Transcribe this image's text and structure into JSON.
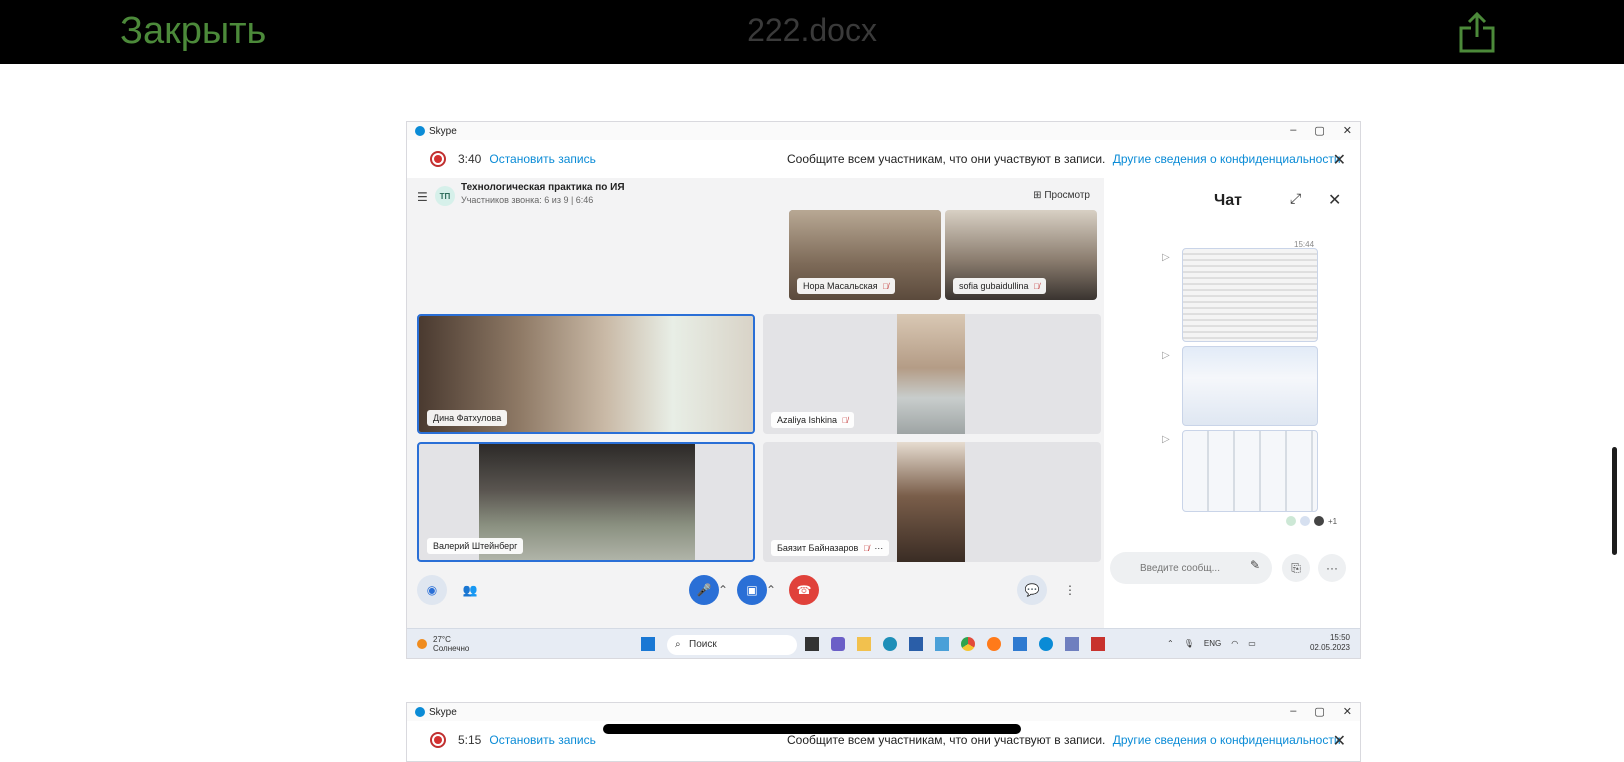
{
  "viewer": {
    "close_label": "Закрыть",
    "doc_title": "222.docx",
    "share_icon": "share-icon",
    "accent_color": "#4c8a3a"
  },
  "window": {
    "app_title": "Skype",
    "controls": [
      "–",
      "▢",
      "✕"
    ]
  },
  "recording": {
    "time": "3:40",
    "stop_label": "Остановить запись",
    "notice": "Сообщите всем участникам, что они участвуют в записи.",
    "privacy_link": "Другие сведения о конфиденциальности"
  },
  "call": {
    "avatar_initials": "ТП",
    "title": "Технологическая практика по ИЯ",
    "subtitle": "Участников звонка: 6 из 9 | 6:46",
    "view_label": "Просмотр"
  },
  "participants": [
    {
      "name": "Нора Масальская"
    },
    {
      "name": "sofia gubaidullina"
    },
    {
      "name": "Дина Фатхулова"
    },
    {
      "name": "Azaliya Ishkina"
    },
    {
      "name": "Валерий Штейнберг"
    },
    {
      "name": "Баязит Байназаров"
    }
  ],
  "chat": {
    "title": "Чат",
    "time": "15:44",
    "extra_readers": "+1",
    "input_placeholder": "Введите сообщ..."
  },
  "taskbar": {
    "temperature": "27°C",
    "weather": "Солнечно",
    "search": "Поиск",
    "lang": "ENG",
    "clock_time": "15:50",
    "clock_date": "02.05.2023"
  },
  "second_shot": {
    "app_title": "Skype",
    "time": "5:15",
    "stop_label": "Остановить запись",
    "notice": "Сообщите всем участникам, что они участвуют в записи.",
    "privacy_link": "Другие сведения о конфиденциальности"
  }
}
